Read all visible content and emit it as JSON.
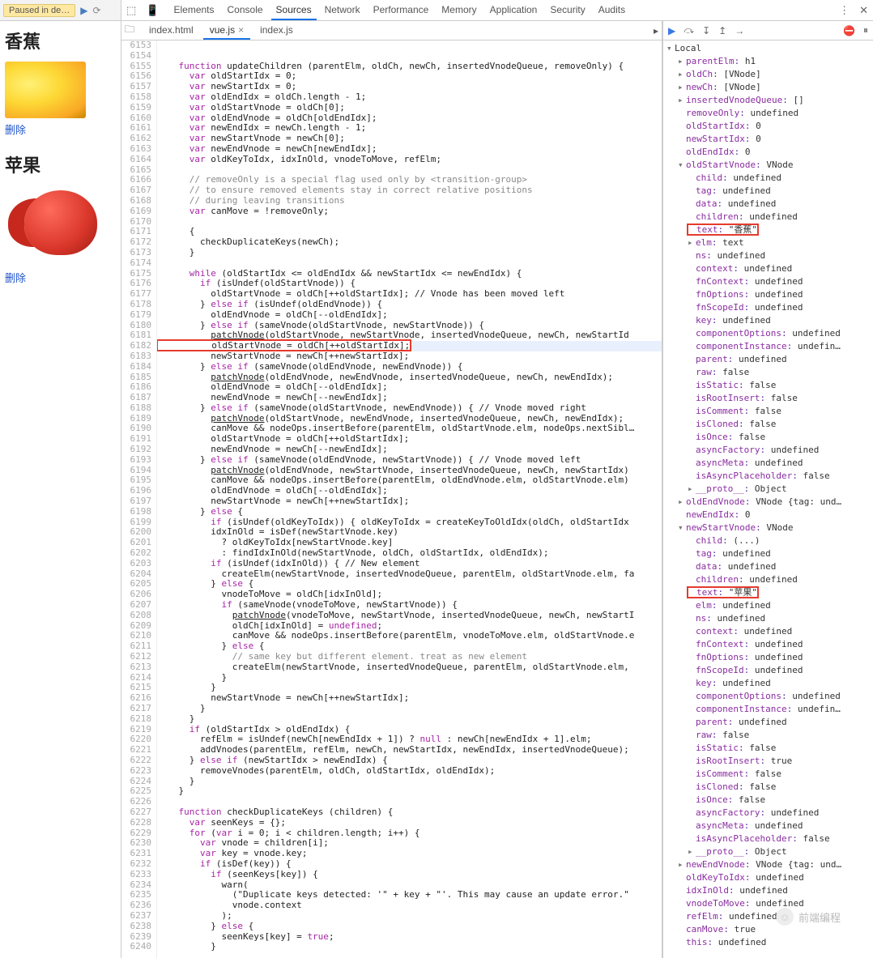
{
  "page": {
    "pausedBadge": "Paused in de…",
    "resumeIcon": "▶",
    "stepIcon": "⟳",
    "h1a": "香蕉",
    "h1b": "苹果",
    "deleteLink": "删除"
  },
  "devtools": {
    "inspectIcon": "⬚",
    "deviceIcon": "📱",
    "tabs": [
      "Elements",
      "Console",
      "Sources",
      "Network",
      "Performance",
      "Memory",
      "Application",
      "Security",
      "Audits"
    ],
    "activeTab": "Sources",
    "menuIcon": "⋮",
    "closeIcon": "✕",
    "fileTabs": {
      "navIcon": "🗀",
      "items": [
        "index.html",
        "vue.js",
        "index.js"
      ],
      "active": "vue.js",
      "moreIcon": "▸"
    },
    "dbgTools": {
      "resume": "▶",
      "stepOver": "⤼",
      "stepInto": "↧",
      "stepOut": "↥",
      "step": "→",
      "deactivate": "⛔",
      "pauseExc": "⏸"
    }
  },
  "editor": {
    "startLine": 6153,
    "execLine": 6182,
    "lines": [
      "",
      "",
      "    function updateChildren (parentElm, oldCh, newCh, insertedVnodeQueue, removeOnly) {",
      "      var oldStartIdx = 0;",
      "      var newStartIdx = 0;",
      "      var oldEndIdx = oldCh.length - 1;",
      "      var oldStartVnode = oldCh[0];",
      "      var oldEndVnode = oldCh[oldEndIdx];",
      "      var newEndIdx = newCh.length - 1;",
      "      var newStartVnode = newCh[0];",
      "      var newEndVnode = newCh[newEndIdx];",
      "      var oldKeyToIdx, idxInOld, vnodeToMove, refElm;",
      "",
      "      // removeOnly is a special flag used only by <transition-group>",
      "      // to ensure removed elements stay in correct relative positions",
      "      // during leaving transitions",
      "      var canMove = !removeOnly;",
      "",
      "      {",
      "        checkDuplicateKeys(newCh);",
      "      }",
      "",
      "      while (oldStartIdx <= oldEndIdx && newStartIdx <= newEndIdx) {",
      "        if (isUndef(oldStartVnode)) {",
      "          oldStartVnode = oldCh[++oldStartIdx]; // Vnode has been moved left",
      "        } else if (isUndef(oldEndVnode)) {",
      "          oldEndVnode = oldCh[--oldEndIdx];",
      "        } else if (sameVnode(oldStartVnode, newStartVnode)) {",
      "          patchVnode(oldStartVnode, newStartVnode, insertedVnodeQueue, newCh, newStartId",
      "          oldStartVnode = oldCh[++oldStartIdx];",
      "          newStartVnode = newCh[++newStartIdx];",
      "        } else if (sameVnode(oldEndVnode, newEndVnode)) {",
      "          patchVnode(oldEndVnode, newEndVnode, insertedVnodeQueue, newCh, newEndIdx);",
      "          oldEndVnode = oldCh[--oldEndIdx];",
      "          newEndVnode = newCh[--newEndIdx];",
      "        } else if (sameVnode(oldStartVnode, newEndVnode)) { // Vnode moved right",
      "          patchVnode(oldStartVnode, newEndVnode, insertedVnodeQueue, newCh, newEndIdx);",
      "          canMove && nodeOps.insertBefore(parentElm, oldStartVnode.elm, nodeOps.nextSibl…",
      "          oldStartVnode = oldCh[++oldStartIdx];",
      "          newEndVnode = newCh[--newEndIdx];",
      "        } else if (sameVnode(oldEndVnode, newStartVnode)) { // Vnode moved left",
      "          patchVnode(oldEndVnode, newStartVnode, insertedVnodeQueue, newCh, newStartIdx)",
      "          canMove && nodeOps.insertBefore(parentElm, oldEndVnode.elm, oldStartVnode.elm)",
      "          oldEndVnode = oldCh[--oldEndIdx];",
      "          newStartVnode = newCh[++newStartIdx];",
      "        } else {",
      "          if (isUndef(oldKeyToIdx)) { oldKeyToIdx = createKeyToOldIdx(oldCh, oldStartIdx",
      "          idxInOld = isDef(newStartVnode.key)",
      "            ? oldKeyToIdx[newStartVnode.key]",
      "            : findIdxInOld(newStartVnode, oldCh, oldStartIdx, oldEndIdx);",
      "          if (isUndef(idxInOld)) { // New element",
      "            createElm(newStartVnode, insertedVnodeQueue, parentElm, oldStartVnode.elm, fa",
      "          } else {",
      "            vnodeToMove = oldCh[idxInOld];",
      "            if (sameVnode(vnodeToMove, newStartVnode)) {",
      "              patchVnode(vnodeToMove, newStartVnode, insertedVnodeQueue, newCh, newStartI",
      "              oldCh[idxInOld] = undefined;",
      "              canMove && nodeOps.insertBefore(parentElm, vnodeToMove.elm, oldStartVnode.e",
      "            } else {",
      "              // same key but different element. treat as new element",
      "              createElm(newStartVnode, insertedVnodeQueue, parentElm, oldStartVnode.elm,",
      "            }",
      "          }",
      "          newStartVnode = newCh[++newStartIdx];",
      "        }",
      "      }",
      "      if (oldStartIdx > oldEndIdx) {",
      "        refElm = isUndef(newCh[newEndIdx + 1]) ? null : newCh[newEndIdx + 1].elm;",
      "        addVnodes(parentElm, refElm, newCh, newStartIdx, newEndIdx, insertedVnodeQueue);",
      "      } else if (newStartIdx > newEndIdx) {",
      "        removeVnodes(parentElm, oldCh, oldStartIdx, oldEndIdx);",
      "      }",
      "    }",
      "",
      "    function checkDuplicateKeys (children) {",
      "      var seenKeys = {};",
      "      for (var i = 0; i < children.length; i++) {",
      "        var vnode = children[i];",
      "        var key = vnode.key;",
      "        if (isDef(key)) {",
      "          if (seenKeys[key]) {",
      "            warn(",
      "              (\"Duplicate keys detected: '\" + key + \"'. This may cause an update error.\"",
      "              vnode.context",
      "            );",
      "          } else {",
      "            seenKeys[key] = true;",
      "          }"
    ]
  },
  "scope": {
    "header": "Local",
    "rows": [
      {
        "ind": 1,
        "arr": "▸",
        "k": "parentElm",
        "v": " h1"
      },
      {
        "ind": 1,
        "arr": "▸",
        "k": "oldCh",
        "v": " [VNode]"
      },
      {
        "ind": 1,
        "arr": "▸",
        "k": "newCh",
        "v": " [VNode]"
      },
      {
        "ind": 1,
        "arr": "▸",
        "k": "insertedVnodeQueue",
        "v": " []"
      },
      {
        "ind": 1,
        "arr": "",
        "k": "removeOnly",
        "v": " undefined"
      },
      {
        "ind": 1,
        "arr": "",
        "k": "oldStartIdx",
        "v": " 0"
      },
      {
        "ind": 1,
        "arr": "",
        "k": "newStartIdx",
        "v": " 0"
      },
      {
        "ind": 1,
        "arr": "",
        "k": "oldEndIdx",
        "v": " 0"
      },
      {
        "ind": 1,
        "arr": "▾",
        "k": "oldStartVnode",
        "v": " VNode"
      },
      {
        "ind": 2,
        "arr": "",
        "k": "child",
        "v": " undefined"
      },
      {
        "ind": 2,
        "arr": "",
        "k": "tag",
        "v": " undefined"
      },
      {
        "ind": 2,
        "arr": "",
        "k": "data",
        "v": " undefined"
      },
      {
        "ind": 2,
        "arr": "",
        "k": "children",
        "v": " undefined"
      },
      {
        "ind": 2,
        "arr": "",
        "k": "text",
        "v": " \"香蕉\"",
        "box": true
      },
      {
        "ind": 2,
        "arr": "▸",
        "k": "elm",
        "v": " text"
      },
      {
        "ind": 2,
        "arr": "",
        "k": "ns",
        "v": " undefined"
      },
      {
        "ind": 2,
        "arr": "",
        "k": "context",
        "v": " undefined"
      },
      {
        "ind": 2,
        "arr": "",
        "k": "fnContext",
        "v": " undefined"
      },
      {
        "ind": 2,
        "arr": "",
        "k": "fnOptions",
        "v": " undefined"
      },
      {
        "ind": 2,
        "arr": "",
        "k": "fnScopeId",
        "v": " undefined"
      },
      {
        "ind": 2,
        "arr": "",
        "k": "key",
        "v": " undefined"
      },
      {
        "ind": 2,
        "arr": "",
        "k": "componentOptions",
        "v": " undefined"
      },
      {
        "ind": 2,
        "arr": "",
        "k": "componentInstance",
        "v": " undefin…"
      },
      {
        "ind": 2,
        "arr": "",
        "k": "parent",
        "v": " undefined"
      },
      {
        "ind": 2,
        "arr": "",
        "k": "raw",
        "v": " false"
      },
      {
        "ind": 2,
        "arr": "",
        "k": "isStatic",
        "v": " false"
      },
      {
        "ind": 2,
        "arr": "",
        "k": "isRootInsert",
        "v": " false"
      },
      {
        "ind": 2,
        "arr": "",
        "k": "isComment",
        "v": " false"
      },
      {
        "ind": 2,
        "arr": "",
        "k": "isCloned",
        "v": " false"
      },
      {
        "ind": 2,
        "arr": "",
        "k": "isOnce",
        "v": " false"
      },
      {
        "ind": 2,
        "arr": "",
        "k": "asyncFactory",
        "v": " undefined"
      },
      {
        "ind": 2,
        "arr": "",
        "k": "asyncMeta",
        "v": " undefined"
      },
      {
        "ind": 2,
        "arr": "",
        "k": "isAsyncPlaceholder",
        "v": " false"
      },
      {
        "ind": 2,
        "arr": "▸",
        "k": "__proto__",
        "v": " Object"
      },
      {
        "ind": 1,
        "arr": "▸",
        "k": "oldEndVnode",
        "v": " VNode {tag: und…"
      },
      {
        "ind": 1,
        "arr": "",
        "k": "newEndIdx",
        "v": " 0"
      },
      {
        "ind": 1,
        "arr": "▾",
        "k": "newStartVnode",
        "v": " VNode"
      },
      {
        "ind": 2,
        "arr": "",
        "k": "child",
        "v": " (...)"
      },
      {
        "ind": 2,
        "arr": "",
        "k": "tag",
        "v": " undefined"
      },
      {
        "ind": 2,
        "arr": "",
        "k": "data",
        "v": " undefined"
      },
      {
        "ind": 2,
        "arr": "",
        "k": "children",
        "v": " undefined"
      },
      {
        "ind": 2,
        "arr": "",
        "k": "text",
        "v": " \"苹果\"",
        "box": true
      },
      {
        "ind": 2,
        "arr": "",
        "k": "elm",
        "v": " undefined"
      },
      {
        "ind": 2,
        "arr": "",
        "k": "ns",
        "v": " undefined"
      },
      {
        "ind": 2,
        "arr": "",
        "k": "context",
        "v": " undefined"
      },
      {
        "ind": 2,
        "arr": "",
        "k": "fnContext",
        "v": " undefined"
      },
      {
        "ind": 2,
        "arr": "",
        "k": "fnOptions",
        "v": " undefined"
      },
      {
        "ind": 2,
        "arr": "",
        "k": "fnScopeId",
        "v": " undefined"
      },
      {
        "ind": 2,
        "arr": "",
        "k": "key",
        "v": " undefined"
      },
      {
        "ind": 2,
        "arr": "",
        "k": "componentOptions",
        "v": " undefined"
      },
      {
        "ind": 2,
        "arr": "",
        "k": "componentInstance",
        "v": " undefin…"
      },
      {
        "ind": 2,
        "arr": "",
        "k": "parent",
        "v": " undefined"
      },
      {
        "ind": 2,
        "arr": "",
        "k": "raw",
        "v": " false"
      },
      {
        "ind": 2,
        "arr": "",
        "k": "isStatic",
        "v": " false"
      },
      {
        "ind": 2,
        "arr": "",
        "k": "isRootInsert",
        "v": " true"
      },
      {
        "ind": 2,
        "arr": "",
        "k": "isComment",
        "v": " false"
      },
      {
        "ind": 2,
        "arr": "",
        "k": "isCloned",
        "v": " false"
      },
      {
        "ind": 2,
        "arr": "",
        "k": "isOnce",
        "v": " false"
      },
      {
        "ind": 2,
        "arr": "",
        "k": "asyncFactory",
        "v": " undefined"
      },
      {
        "ind": 2,
        "arr": "",
        "k": "asyncMeta",
        "v": " undefined"
      },
      {
        "ind": 2,
        "arr": "",
        "k": "isAsyncPlaceholder",
        "v": " false"
      },
      {
        "ind": 2,
        "arr": "▸",
        "k": "__proto__",
        "v": " Object"
      },
      {
        "ind": 1,
        "arr": "▸",
        "k": "newEndVnode",
        "v": " VNode {tag: und…"
      },
      {
        "ind": 1,
        "arr": "",
        "k": "oldKeyToIdx",
        "v": " undefined"
      },
      {
        "ind": 1,
        "arr": "",
        "k": "idxInOld",
        "v": " undefined"
      },
      {
        "ind": 1,
        "arr": "",
        "k": "vnodeToMove",
        "v": " undefined"
      },
      {
        "ind": 1,
        "arr": "",
        "k": "refElm",
        "v": " undefined"
      },
      {
        "ind": 1,
        "arr": "",
        "k": "canMove",
        "v": " true"
      },
      {
        "ind": 1,
        "arr": "",
        "k": "this",
        "v": " undefined"
      }
    ]
  },
  "watermark": "前端编程"
}
